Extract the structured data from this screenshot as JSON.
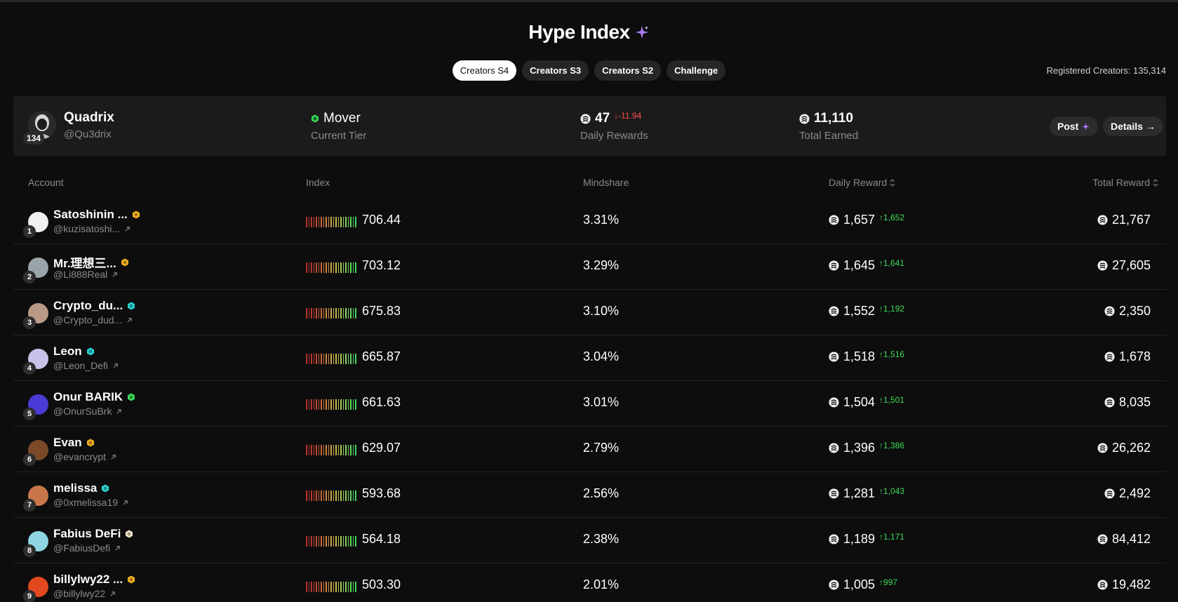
{
  "header": {
    "title": "Hype Index",
    "registered_label": "Registered Creators: 135,314"
  },
  "tabs": [
    {
      "label": "Creators S4",
      "active": true
    },
    {
      "label": "Creators S3",
      "active": false
    },
    {
      "label": "Creators S2",
      "active": false
    },
    {
      "label": "Challenge",
      "active": false
    }
  ],
  "profile": {
    "name": "Quadrix",
    "handle": "@Qu3drix",
    "rank": "134",
    "tier": {
      "value": "Mover",
      "label": "Current Tier"
    },
    "daily": {
      "value": "47",
      "delta": "-11.94",
      "label": "Daily Rewards"
    },
    "total": {
      "value": "11,110",
      "label": "Total Earned"
    },
    "post_label": "Post",
    "details_label": "Details"
  },
  "columns": {
    "account": "Account",
    "index": "Index",
    "mindshare": "Mindshare",
    "daily_reward": "Daily Reward",
    "total_reward": "Total Reward"
  },
  "colors": {
    "background": "#0d0d0d",
    "positive": "#3ddc5a",
    "negative": "#ff4b4b",
    "badge_gold": "#f5b120",
    "badge_cyan": "#2ad4d4",
    "badge_green": "#3ddc5a",
    "badge_white": "#f3e6c9"
  },
  "rows": [
    {
      "rank": "1",
      "name": "Satoshinin ...",
      "handle": "@kuzisatoshi...",
      "badge": "gold",
      "index": "706.44",
      "mindshare": "3.31%",
      "daily": "1,657",
      "daily_delta": "1,652",
      "total": "21,767",
      "avatar_color": "#f0f0f0"
    },
    {
      "rank": "2",
      "name": "Mr.理想三...",
      "handle": "@Li888Real",
      "badge": "gold",
      "index": "703.12",
      "mindshare": "3.29%",
      "daily": "1,645",
      "daily_delta": "1,641",
      "total": "27,605",
      "avatar_color": "#9aa3a8"
    },
    {
      "rank": "3",
      "name": "Crypto_du...",
      "handle": "@Crypto_dud...",
      "badge": "cyan",
      "index": "675.83",
      "mindshare": "3.10%",
      "daily": "1,552",
      "daily_delta": "1,192",
      "total": "2,350",
      "avatar_color": "#b89a86"
    },
    {
      "rank": "4",
      "name": "Leon",
      "handle": "@Leon_Defi",
      "badge": "cyan",
      "index": "665.87",
      "mindshare": "3.04%",
      "daily": "1,518",
      "daily_delta": "1,516",
      "total": "1,678",
      "avatar_color": "#c9c2e8"
    },
    {
      "rank": "5",
      "name": "Onur BARIK",
      "handle": "@OnurSuBrk",
      "badge": "green",
      "index": "661.63",
      "mindshare": "3.01%",
      "daily": "1,504",
      "daily_delta": "1,501",
      "total": "8,035",
      "avatar_color": "#4b3bd6"
    },
    {
      "rank": "6",
      "name": "Evan",
      "handle": "@evancrypt",
      "badge": "gold",
      "index": "629.07",
      "mindshare": "2.79%",
      "daily": "1,396",
      "daily_delta": "1,386",
      "total": "26,262",
      "avatar_color": "#7a4a28"
    },
    {
      "rank": "7",
      "name": "melissa",
      "handle": "@0xmelissa19",
      "badge": "cyan",
      "index": "593.68",
      "mindshare": "2.56%",
      "daily": "1,281",
      "daily_delta": "1,043",
      "total": "2,492",
      "avatar_color": "#c9774a"
    },
    {
      "rank": "8",
      "name": "Fabius DeFi",
      "handle": "@FabiusDefi",
      "badge": "white",
      "index": "564.18",
      "mindshare": "2.38%",
      "daily": "1,189",
      "daily_delta": "1,171",
      "total": "84,412",
      "avatar_color": "#8fd4e3"
    },
    {
      "rank": "9",
      "name": "billylwy22 ...",
      "handle": "@billylwy22",
      "badge": "gold",
      "index": "503.30",
      "mindshare": "2.01%",
      "daily": "1,005",
      "daily_delta": "997",
      "total": "19,482",
      "avatar_color": "#e2481e"
    }
  ]
}
